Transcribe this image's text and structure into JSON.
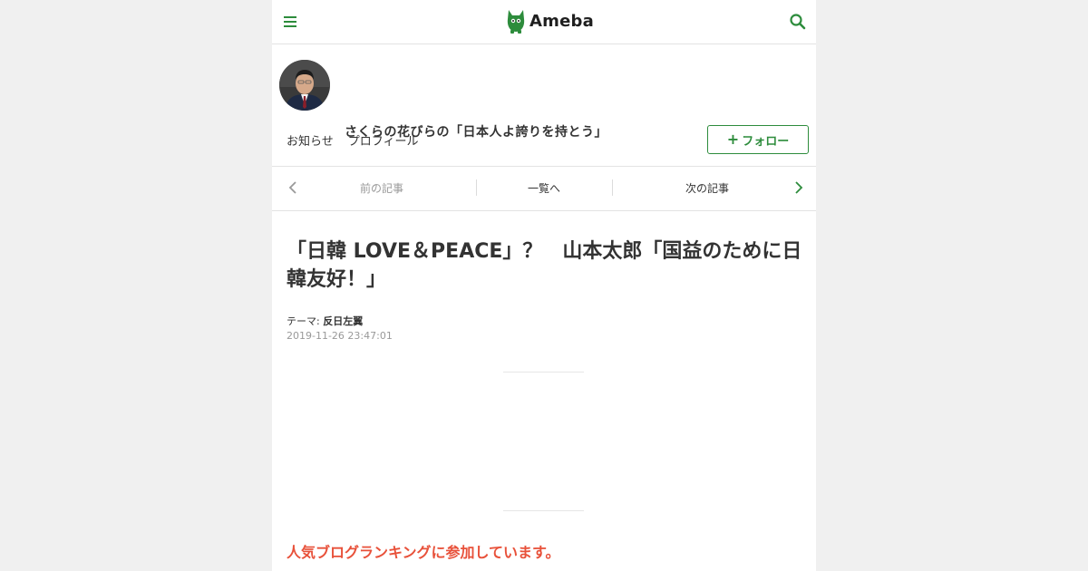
{
  "header": {
    "logo_text": "Ameba",
    "brand_color": "#2d8c3c",
    "menu_icon": "hamburger-icon",
    "search_icon": "search-icon"
  },
  "blog": {
    "title": "さくらの花びらの「日本人よ誇りを持とう」",
    "nav": [
      "お知らせ",
      "プロフィール"
    ],
    "follow_label": "フォロー"
  },
  "pager": {
    "prev": "前の記事",
    "list": "一覧へ",
    "next": "次の記事"
  },
  "article": {
    "title": "「日韓 LOVE＆PEACE」？　山本太郎「国益のために日韓友好！」",
    "theme_label": "テーマ:",
    "theme_value": "反日左翼",
    "date": "2019-11-26 23:47:01",
    "ranking_text": "人気ブログランキングに参加しています。",
    "ranking_color": "#e8513a"
  }
}
